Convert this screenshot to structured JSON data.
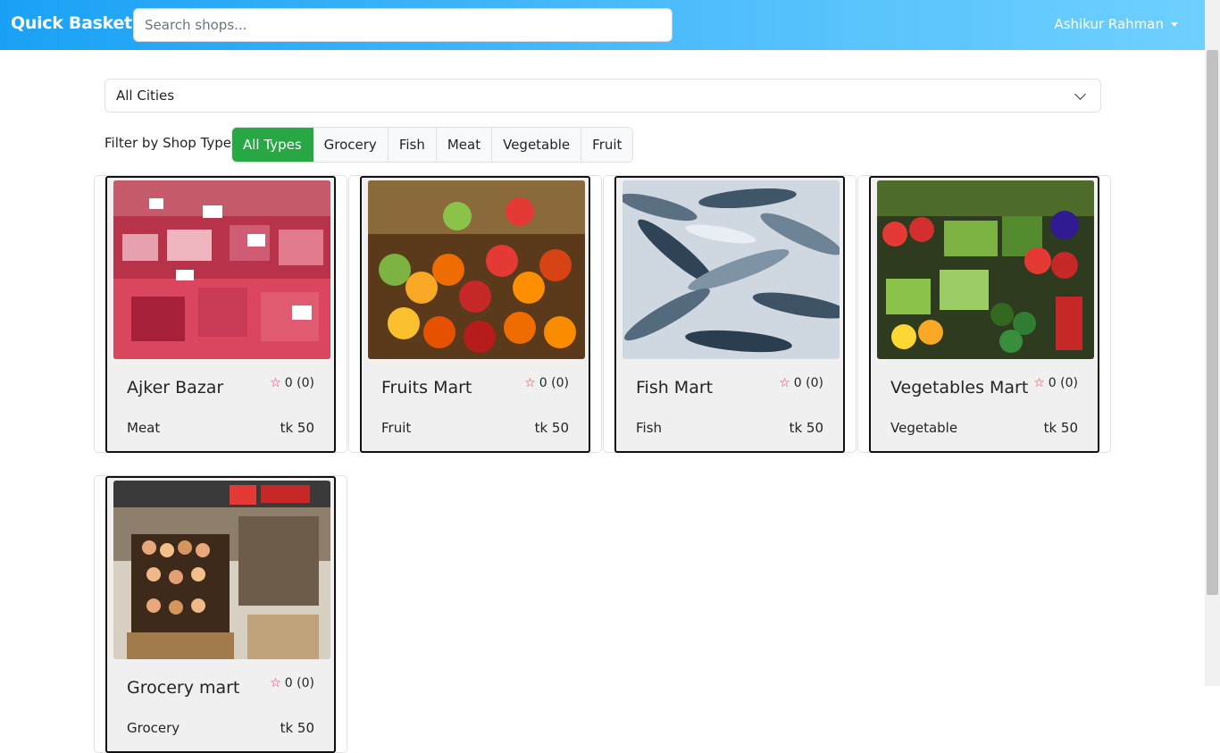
{
  "navbar": {
    "brand": "Quick Basket",
    "search_placeholder": "Search shops...",
    "user_name": "Ashikur Rahman"
  },
  "city_select": {
    "selected": "All Cities"
  },
  "filter": {
    "label": "Filter by Shop Type:",
    "options": [
      "All Types",
      "Grocery",
      "Fish",
      "Meat",
      "Vegetable",
      "Fruit"
    ],
    "active": "All Types"
  },
  "shops": [
    {
      "name": "Ajker Bazar",
      "rating": "0 (0)",
      "type": "Meat",
      "price": "tk 50",
      "image": "meat"
    },
    {
      "name": "Fruits Mart",
      "rating": "0 (0)",
      "type": "Fruit",
      "price": "tk 50",
      "image": "fruit"
    },
    {
      "name": "Fish Mart",
      "rating": "0 (0)",
      "type": "Fish",
      "price": "tk 50",
      "image": "fish"
    },
    {
      "name": "Vegetables Mart",
      "rating": "0 (0)",
      "type": "Vegetable",
      "price": "tk 50",
      "image": "vegetable"
    },
    {
      "name": "Grocery mart",
      "rating": "0 (0)",
      "type": "Grocery",
      "price": "tk 50",
      "image": "grocery"
    }
  ],
  "colors": {
    "accent": "#28a745",
    "star": "#dc3545",
    "nav_start": "#1aa1f5",
    "nav_end": "#6fd0ff"
  }
}
